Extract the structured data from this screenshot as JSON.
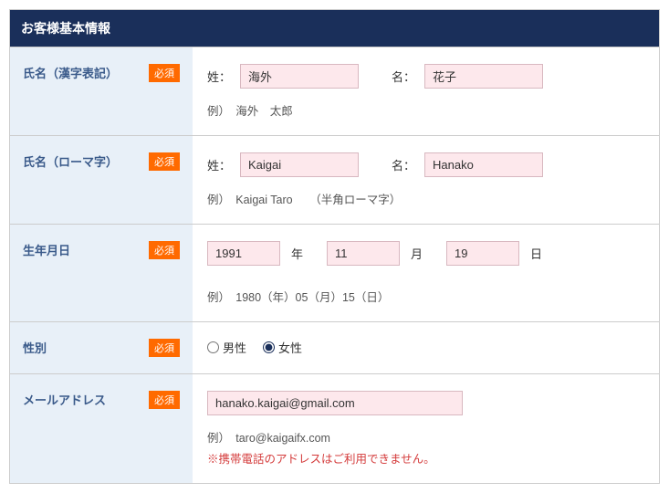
{
  "header": {
    "title": "お客様基本情報"
  },
  "badge": "必須",
  "name_kanji": {
    "label": "氏名（漢字表記）",
    "sei_label": "姓：",
    "sei_value": "海外",
    "mei_label": "名：",
    "mei_value": "花子",
    "example": "例）　海外　太郎"
  },
  "name_roma": {
    "label": "氏名（ローマ字）",
    "sei_label": "姓：",
    "sei_value": "Kaigai",
    "mei_label": "名：",
    "mei_value": "Hanako",
    "example": "例）　Kaigai Taro　　（半角ローマ字）"
  },
  "birth": {
    "label": "生年月日",
    "year": "1991",
    "year_unit": "年",
    "month": "11",
    "month_unit": "月",
    "day": "19",
    "day_unit": "日",
    "example": "例）　1980（年）05（月）15（日）"
  },
  "gender": {
    "label": "性別",
    "male": "男性",
    "female": "女性"
  },
  "email": {
    "label": "メールアドレス",
    "value": "hanako.kaigai@gmail.com",
    "example": "例）　taro@kaigaifx.com",
    "warning": "※携帯電話のアドレスはご利用できません。"
  }
}
